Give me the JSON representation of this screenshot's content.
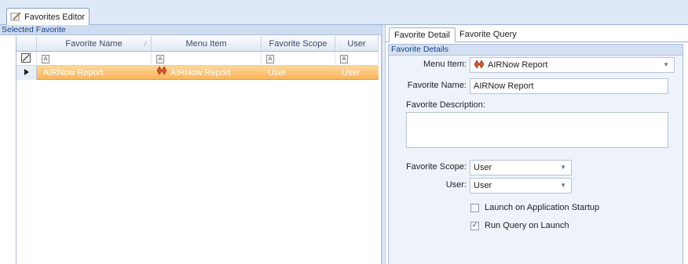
{
  "document_tab": {
    "label": "Favorites Editor",
    "icon": "pencil-note-icon"
  },
  "left_panel": {
    "caption": "Selected Favorite",
    "grid": {
      "columns": [
        "Favorite Name",
        "Menu Item",
        "Favorite Scope",
        "User"
      ],
      "sort_column": "Favorite Name",
      "filter_icon": "filter-text-icon",
      "rows": [
        {
          "favorite_name": "AIRNow Report",
          "menu_item": "AIRNow Report",
          "menu_item_icon": "report-icon",
          "favorite_scope": "User",
          "user": "User",
          "selected": true
        }
      ]
    }
  },
  "right_panel": {
    "tabs": [
      "Favorite Detail",
      "Favorite Query"
    ],
    "active_tab": "Favorite Detail",
    "group_caption": "Favorite Details",
    "form": {
      "menu_item_label": "Menu Item:",
      "menu_item_value": "AIRNow Report",
      "favorite_name_label": "Favorite Name:",
      "favorite_name_value": "AIRNow Report",
      "favorite_description_label": "Favorite Description:",
      "favorite_description_value": "",
      "favorite_scope_label": "Favorite Scope:",
      "favorite_scope_value": "User",
      "user_label": "User:",
      "user_value": "User",
      "launch_on_startup_label": "Launch on Application Startup",
      "launch_on_startup_checked": false,
      "run_query_label": "Run Query on Launch",
      "run_query_checked": true
    }
  },
  "colors": {
    "selection": "#f9b55a",
    "caption_text": "#15428b",
    "chrome": "#dfe8f6"
  }
}
